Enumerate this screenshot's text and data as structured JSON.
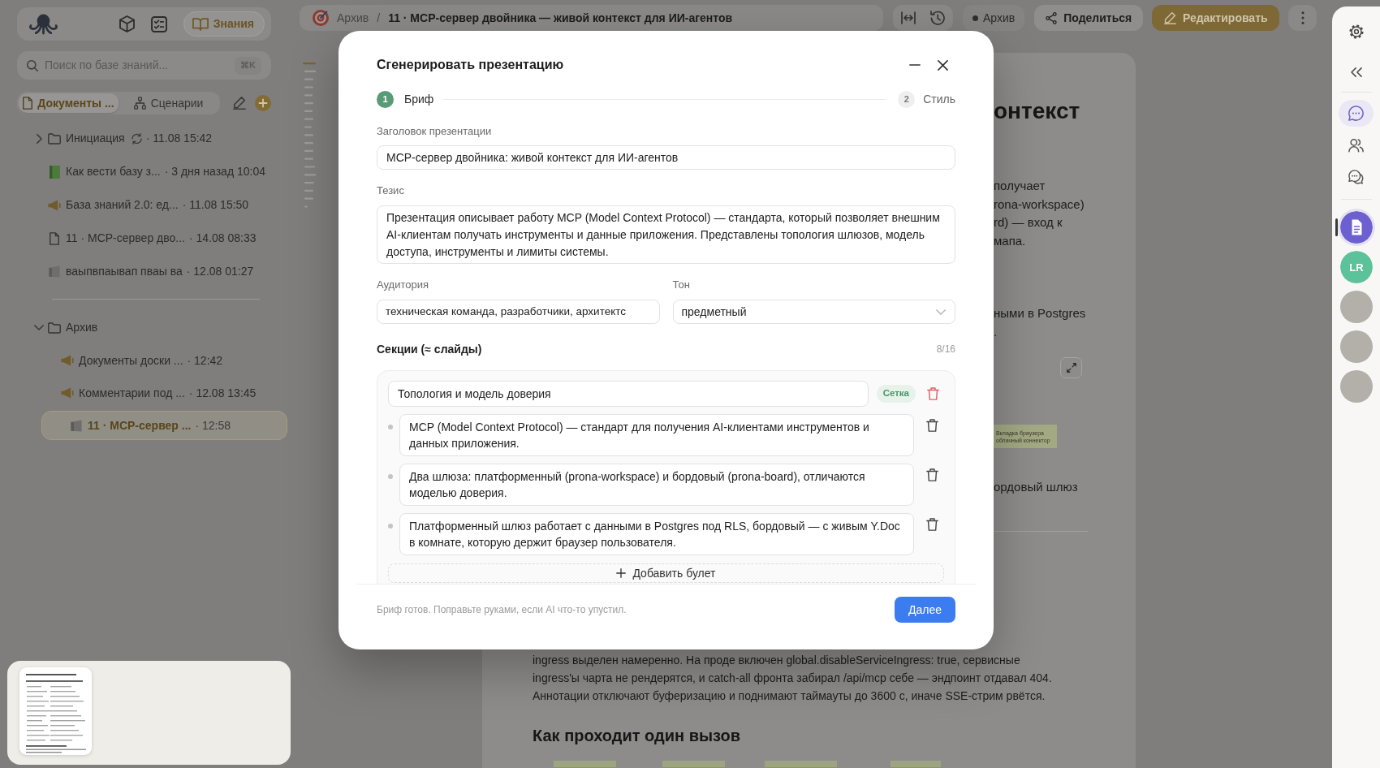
{
  "app_nav": {
    "items": [
      {
        "kind": "cube",
        "selected": false
      },
      {
        "kind": "checklist",
        "selected": false
      },
      {
        "kind": "book",
        "label": "Знания",
        "selected": true
      }
    ]
  },
  "search": {
    "placeholder": "Поиск по базе знаний...",
    "shortcut": "⌘K"
  },
  "sidebar_tabs": [
    {
      "kind": "documents",
      "label": "Документы ...",
      "selected": true
    },
    {
      "kind": "scenarios",
      "label": "Сценарии",
      "selected": false
    }
  ],
  "tree_sections": [
    {
      "items": [
        {
          "kind": "folder",
          "name": "Инициация",
          "syncing": true,
          "meta": "· 11.08 15:42",
          "expanded": false,
          "selected": false
        },
        {
          "kind": "book",
          "name": "Как вести базу з...",
          "meta": "· 3 дня назад 10:04",
          "selected": false
        },
        {
          "kind": "megaphone",
          "name": "База знаний 2.0: ед...",
          "meta": "· 11.08 15:50",
          "selected": false
        },
        {
          "kind": "file",
          "name": "11 · MCP-сервер дво...",
          "meta": "· 14.08 08:33",
          "selected": false
        },
        {
          "kind": "slides",
          "name": "ваыпвпаывап пваы ва",
          "meta": "· 12.08 01:27",
          "selected": false
        }
      ]
    },
    {
      "items": [
        {
          "kind": "folder",
          "name": "Архив",
          "syncing": false,
          "expanded": true,
          "selected": false,
          "children": [
            {
              "kind": "megaphone",
              "name": "Документы доски ...",
              "meta": "· 12:42",
              "selected": false
            },
            {
              "kind": "megaphone",
              "name": "Комментарии под ...",
              "meta": "· 12.08 13:45",
              "selected": false
            },
            {
              "kind": "slides",
              "name": "11 · MCP-сервер ...",
              "meta": "· 12:58",
              "selected": true
            }
          ]
        }
      ]
    }
  ],
  "breadcrumb": {
    "items": [
      "Архив",
      "11 · MCP-сервер двойника — живой контекст для ИИ-агентов"
    ],
    "separator": "/"
  },
  "view_tools": [
    {
      "kind": "fit-width"
    },
    {
      "kind": "history"
    }
  ],
  "status": {
    "label": "Архив"
  },
  "actions": [
    {
      "kind": "share",
      "label": "Поделиться"
    },
    {
      "kind": "edit",
      "label": "Редактировать"
    },
    {
      "kind": "more"
    }
  ],
  "document": {
    "side_blocks": [
      {
        "kind": "heading",
        "text": "онтекст"
      },
      {
        "kind": "paragraph",
        "lines": [
          "получает",
          "rona-workspace)",
          "rd) — вход к",
          "мапа."
        ]
      },
      {
        "kind": "paragraph",
        "lines": [
          "ными в Postgres",
          "."
        ]
      },
      {
        "kind": "expand_button"
      },
      {
        "kind": "diagram_node",
        "lines": [
          "Вкладка браузера",
          "облачный коннектор"
        ]
      },
      {
        "kind": "paragraph",
        "lines": [
          "ордовый шлюз"
        ]
      },
      {
        "kind": "rule"
      }
    ],
    "paragraph_lines": [
      "ingress выделен намеренно. На проде включен global.disableServiceIngress: true, сервисные",
      "ingress'ы чарта не рендерятся, и catch-all фронта забирал /api/mcp себе — эндпоинт отдавал 404.",
      "Аннотации отключают буферизацию и поднимают таймауты до 3600 с, иначе SSE-стрим рвётся."
    ],
    "heading": "Как проходит один вызов"
  },
  "right_rail": {
    "tools": [
      {
        "kind": "chat",
        "selected": true
      },
      {
        "kind": "people",
        "selected": false
      },
      {
        "kind": "comments",
        "selected": false
      }
    ],
    "participants": [
      {
        "kind": "document",
        "color": "#6c5fd0",
        "selected": true
      },
      {
        "kind": "initials",
        "initials": "LR",
        "color": "#5cc29a",
        "selected": false
      },
      {
        "kind": "photo",
        "selected": false
      },
      {
        "kind": "photo",
        "selected": false
      },
      {
        "kind": "photo",
        "selected": false
      }
    ]
  },
  "modal": {
    "title": "Сгенерировать презентацию",
    "steps": [
      {
        "number": "1",
        "label": "Бриф",
        "selected": true
      },
      {
        "number": "2",
        "label": "Стиль",
        "selected": false
      }
    ],
    "title_field": {
      "label": "Заголовок презентации",
      "value": "MCP-сервер двойника: живой контекст для ИИ-агентов"
    },
    "thesis_field": {
      "label": "Тезис",
      "value": "Презентация описывает работу MCP (Model Context Protocol) — стандарта, который позволяет внешним AI-клиентам получать инструменты и данные приложения. Представлены топология шлюзов, модель доступа, инструменты и лимиты системы."
    },
    "audience_field": {
      "label": "Аудитория",
      "value": "техническая команда, разработчики, архитектс"
    },
    "tone_field": {
      "label": "Тон",
      "value": "предметный"
    },
    "sections_label": "Секции (≈ слайды)",
    "sections_count": "8/16",
    "sections": [
      {
        "title": "Топология и модель доверия",
        "layout": "Сетка",
        "bullets": [
          "MCP (Model Context Protocol) — стандарт для получения AI-клиентами инструментов и данных приложения.",
          "Два шлюза: платформенный (prona-workspace) и бордовый (prona-board), отличаются моделью доверия.",
          "Платформенный шлюз работает с данными в Postgres под RLS, бордовый — с живым Y.Doc в комнате, которую держит браузер пользователя."
        ],
        "add_label": "Добавить булет"
      }
    ],
    "footer_hint": "Бриф готов. Поправьте руками, если AI что-то упустил.",
    "next_label": "Далее"
  }
}
